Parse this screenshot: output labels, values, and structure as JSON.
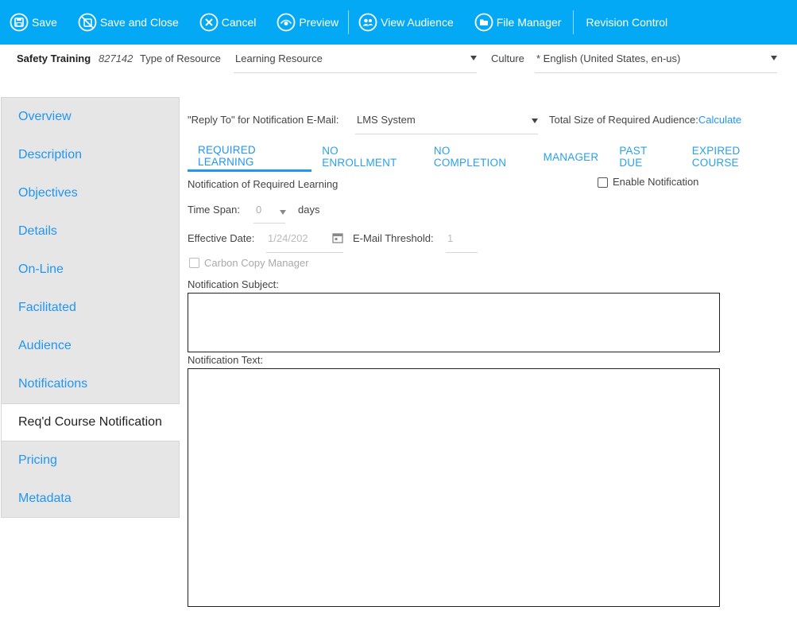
{
  "toolbar": {
    "save": "Save",
    "save_close": "Save and Close",
    "cancel": "Cancel",
    "preview": "Preview",
    "view_audience": "View Audience",
    "file_manager": "File Manager",
    "revision_control": "Revision Control"
  },
  "resource": {
    "name": "Safety Training",
    "id": "827142",
    "type_label": "Type of Resource",
    "type_value": "Learning Resource",
    "culture_label": "Culture",
    "culture_value": "* English (United States, en-us)"
  },
  "sidebar": {
    "items": [
      {
        "label": "Overview"
      },
      {
        "label": "Description"
      },
      {
        "label": "Objectives"
      },
      {
        "label": "Details"
      },
      {
        "label": "On-Line"
      },
      {
        "label": "Facilitated"
      },
      {
        "label": "Audience"
      },
      {
        "label": "Notifications"
      },
      {
        "label": "Req'd Course Notification"
      },
      {
        "label": "Pricing"
      },
      {
        "label": "Metadata"
      }
    ],
    "active_index": 8
  },
  "main": {
    "reply_to_label": "\"Reply To\" for Notification E-Mail:",
    "reply_to_value": "LMS System",
    "total_size_label": "Total Size of Required Audience:",
    "total_size_link": "Calculate",
    "tabs": [
      {
        "label": "Required Learning"
      },
      {
        "label": "No Enrollment"
      },
      {
        "label": "No Completion"
      },
      {
        "label": "Manager"
      },
      {
        "label": "Past Due"
      },
      {
        "label": "Expired Course"
      }
    ],
    "active_tab": 0,
    "section_title": "Notification of Required Learning",
    "enable_notification": "Enable Notification",
    "time_span_label": "Time Span:",
    "time_span_value": "0",
    "time_span_unit": "days",
    "effective_date_label": "Effective Date:",
    "effective_date_value": "1/24/202",
    "email_threshold_label": "E-Mail Threshold:",
    "email_threshold_value": "1",
    "carbon_copy_label": "Carbon Copy Manager",
    "subject_label": "Notification Subject:",
    "text_label": "Notification Text:"
  },
  "colors": {
    "toolbar": "#03a9f4",
    "link": "#2196f3",
    "sidebar_bg": "#e6e6e6"
  }
}
